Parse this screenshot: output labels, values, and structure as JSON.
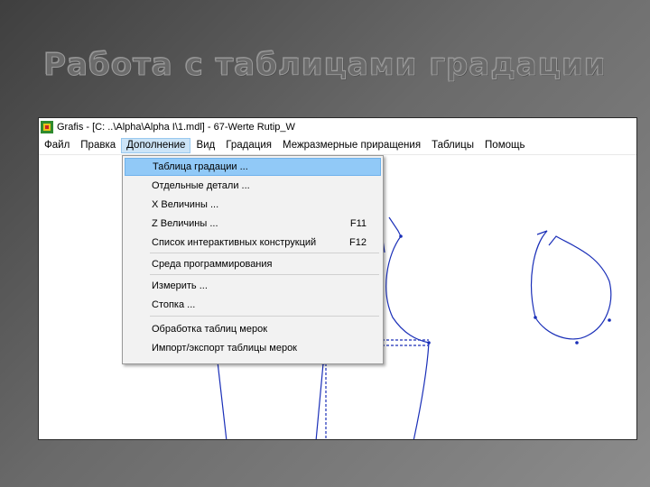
{
  "slide": {
    "title": "Работа с таблицами градации"
  },
  "window": {
    "title": "Grafis - [C: ..\\Alpha\\Alpha I\\1.mdl] - 67-Werte Rutip_W"
  },
  "menubar": [
    "Файл",
    "Правка",
    "Дополнение",
    "Вид",
    "Градация",
    "Межразмерные приращения",
    "Таблицы",
    "Помощь"
  ],
  "dropdown": {
    "items": [
      {
        "label": "Таблица градации ...",
        "shortcut": ""
      },
      {
        "label": "Отдельные детали ...",
        "shortcut": ""
      },
      {
        "label": "X Величины ...",
        "shortcut": ""
      },
      {
        "label": "Z Величины ...",
        "shortcut": "F11"
      },
      {
        "label": "Список интерактивных конструкций",
        "shortcut": "F12"
      },
      {
        "label": "Среда программирования",
        "shortcut": ""
      },
      {
        "label": "Измерить ...",
        "shortcut": ""
      },
      {
        "label": "Стопка ...",
        "shortcut": ""
      },
      {
        "label": "Обработка таблиц мерок",
        "shortcut": ""
      },
      {
        "label": "Импорт/экспорт таблицы мерок",
        "shortcut": ""
      }
    ]
  },
  "colors": {
    "pattern_line": "#1a2fb8",
    "menu_highlight": "#91c9f7"
  }
}
